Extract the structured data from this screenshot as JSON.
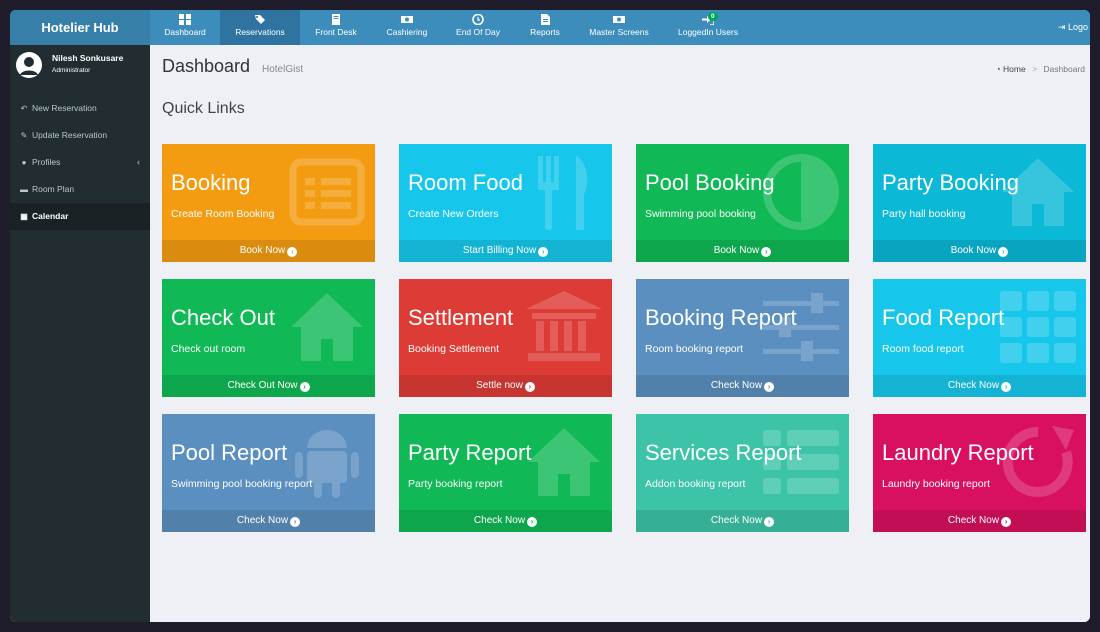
{
  "app": {
    "brand": "Hotelier Hub"
  },
  "nav": [
    {
      "label": "Dashboard",
      "icon": "dashboard-icon"
    },
    {
      "label": "Reservations",
      "icon": "tag-icon"
    },
    {
      "label": "Front Desk",
      "icon": "book-icon"
    },
    {
      "label": "Cashiering",
      "icon": "money-icon"
    },
    {
      "label": "End Of Day",
      "icon": "clock-icon"
    },
    {
      "label": "Reports",
      "icon": "file-icon"
    },
    {
      "label": "Master Screens",
      "icon": "money-icon"
    },
    {
      "label": "LoggedIn Users",
      "icon": "sign-in-icon",
      "badge": "0"
    }
  ],
  "logout": {
    "label": "Logo"
  },
  "user": {
    "name": "Nilesh Sonkusare",
    "role": "Administrator"
  },
  "sidebar": [
    {
      "label": "New Reservation",
      "icon": "reply-icon"
    },
    {
      "label": "Update Reservation",
      "icon": "edit-icon"
    },
    {
      "label": "Profiles",
      "icon": "user-icon"
    },
    {
      "label": "Room Plan",
      "icon": "bed-icon"
    },
    {
      "label": "Calendar",
      "icon": "calendar-icon"
    }
  ],
  "header": {
    "title": "Dashboard",
    "subtitle": "HotelGist"
  },
  "breadcrumb": {
    "home": "Home",
    "separator": ">",
    "current": "Dashboard"
  },
  "section": {
    "title": "Quick Links"
  },
  "tiles": [
    {
      "title": "Booking",
      "subtitle": "Create Room Booking",
      "action": "Book Now",
      "color": "#f39c12",
      "icon": "list-alt-icon"
    },
    {
      "title": "Room Food",
      "subtitle": "Create New Orders",
      "action": "Start Billing Now",
      "color": "#17c7eb",
      "icon": "cutlery-icon"
    },
    {
      "title": "Pool Booking",
      "subtitle": "Swimming pool booking",
      "action": "Book Now",
      "color": "#10b955",
      "icon": "adjust-icon"
    },
    {
      "title": "Party Booking",
      "subtitle": "Party hall booking",
      "action": "Book Now",
      "color": "#0bb8d6",
      "icon": "home-icon"
    },
    {
      "title": "Check Out",
      "subtitle": "Check out room",
      "action": "Check Out Now",
      "color": "#10b955",
      "icon": "home-icon"
    },
    {
      "title": "Settlement",
      "subtitle": "Booking Settlement",
      "action": "Settle now",
      "color": "#dd3b35",
      "icon": "bank-icon"
    },
    {
      "title": "Booking Report",
      "subtitle": "Room booking report",
      "action": "Check Now",
      "color": "#5b8fbf",
      "icon": "sliders-icon"
    },
    {
      "title": "Food Report",
      "subtitle": "Room food report",
      "action": "Check Now",
      "color": "#17c7eb",
      "icon": "grid-icon"
    },
    {
      "title": "Pool Report",
      "subtitle": "Swimming pool booking report",
      "action": "Check Now",
      "color": "#5b8fbf",
      "icon": "android-icon"
    },
    {
      "title": "Party Report",
      "subtitle": "Party booking report",
      "action": "Check Now",
      "color": "#10b955",
      "icon": "home-icon"
    },
    {
      "title": "Services Report",
      "subtitle": "Addon booking report",
      "action": "Check Now",
      "color": "#3cc3a8",
      "icon": "th-list-icon"
    },
    {
      "title": "Laundry Report",
      "subtitle": "Laundry booking report",
      "action": "Check Now",
      "color": "#d9105f",
      "icon": "refresh-icon"
    }
  ]
}
